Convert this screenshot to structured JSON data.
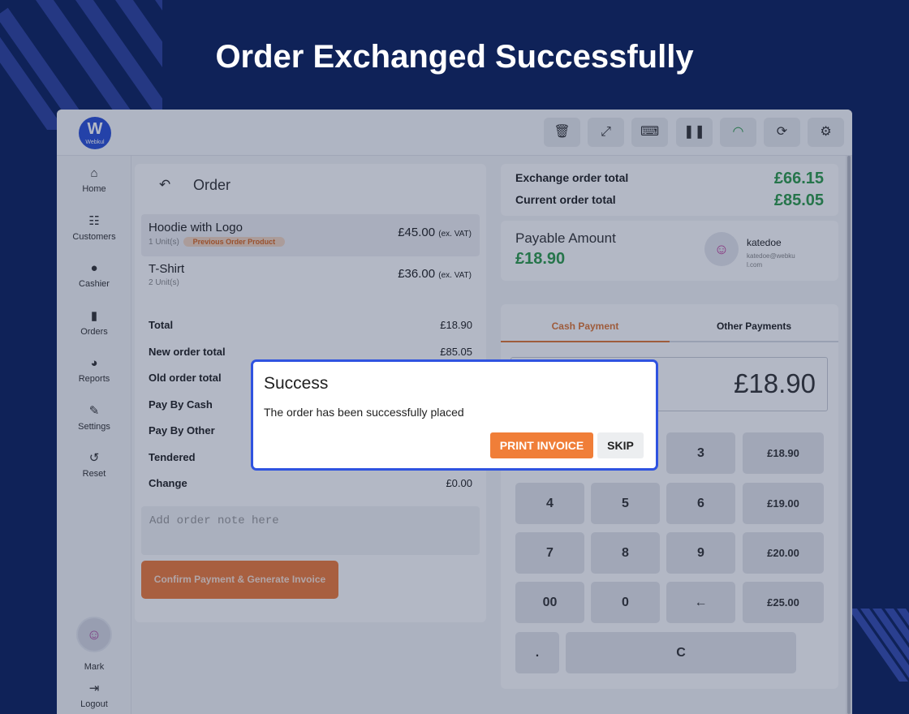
{
  "headline": "Order Exchanged Successfully",
  "logo": {
    "mark": "W",
    "text": "Webkul"
  },
  "toolbar": {
    "icons": [
      "trash-icon",
      "fullscreen-icon",
      "keyboard-icon",
      "pause-icon",
      "wifi-icon",
      "sync-icon",
      "settings-icon"
    ]
  },
  "sidebar": {
    "items": [
      {
        "label": "Home",
        "icon": "home-icon"
      },
      {
        "label": "Customers",
        "icon": "customers-icon"
      },
      {
        "label": "Cashier",
        "icon": "cashier-icon"
      },
      {
        "label": "Orders",
        "icon": "orders-icon"
      },
      {
        "label": "Reports",
        "icon": "reports-icon"
      },
      {
        "label": "Settings",
        "icon": "wrench-icon"
      },
      {
        "label": "Reset",
        "icon": "reset-icon"
      }
    ],
    "user": "Mark",
    "logout": "Logout"
  },
  "order": {
    "title": "Order",
    "items": [
      {
        "name": "Hoodie with Logo",
        "units": "1 Unit(s)",
        "badge": "Previous Order Product",
        "price": "£45.00",
        "tax": "(ex. VAT)"
      },
      {
        "name": "T-Shirt",
        "units": "2 Unit(s)",
        "price": "£36.00",
        "tax": "(ex. VAT)"
      }
    ],
    "summary": [
      {
        "label": "Total",
        "value": "£18.90"
      },
      {
        "label": "New order total",
        "value": "£85.05"
      },
      {
        "label": "Old order total",
        "value": ""
      },
      {
        "label": "Pay By Cash",
        "value": ""
      },
      {
        "label": "Pay By Other",
        "value": ""
      },
      {
        "label": "Tendered",
        "value": ""
      },
      {
        "label": "Change",
        "value": "£0.00"
      }
    ],
    "note_placeholder": "Add order note here",
    "confirm_label": "Confirm Payment & Generate Invoice"
  },
  "totals": {
    "exchange_label": "Exchange order total",
    "exchange_value": "£66.15",
    "current_label": "Current order total",
    "current_value": "£85.05"
  },
  "payable": {
    "label": "Payable Amount",
    "amount": "£18.90",
    "customer_name": "katedoe",
    "customer_email": "katedoe@webkul.com"
  },
  "payment": {
    "tabs": [
      "Cash Payment",
      "Other Payments"
    ],
    "amount": "£18.90",
    "keys": [
      "3",
      "£18.90",
      "4",
      "5",
      "6",
      "£19.00",
      "7",
      "8",
      "9",
      "£20.00",
      "00",
      "0",
      "←",
      "£25.00",
      ".",
      "C"
    ]
  },
  "dialog": {
    "title": "Success",
    "message": "The order has been successfully placed",
    "print_label": "PRINT INVOICE",
    "skip_label": "SKIP"
  },
  "colors": {
    "accent": "#f07e38",
    "green": "#2e9b4a",
    "brand": "#0f2258",
    "dialog_border": "#2f53e0"
  }
}
